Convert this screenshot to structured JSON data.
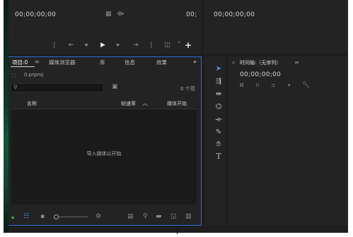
{
  "source_monitor": {
    "timecode_left": "00;00;00;00",
    "timecode_right": "00;",
    "icons": [
      "film-icon",
      "arrow-in-icon",
      "mark-in-icon",
      "mark-in-bracket-icon",
      "step-back-icon",
      "play-icon",
      "step-forward-icon",
      "mark-out-bracket-icon",
      "export-frame-icon",
      "add-icon"
    ]
  },
  "program_monitor": {
    "timecode_left": "00;00;00;00"
  },
  "project_panel": {
    "tabs": [
      {
        "label": "项目:0",
        "active": true
      },
      {
        "label": "媒体浏览器",
        "active": false
      },
      {
        "label": "库",
        "active": false
      },
      {
        "label": "信息",
        "active": false
      },
      {
        "label": "效果",
        "active": false
      }
    ],
    "overflow_label": "»",
    "project_file": "0.prproj",
    "search_placeholder": "",
    "item_count": "0 个项",
    "columns": {
      "name": "名称",
      "frame_rate": "帧速率",
      "media_start": "媒体开始"
    },
    "empty_message": "导入媒体以开始"
  },
  "timeline_panel": {
    "title": "时间轴:（无序列）",
    "timecode": "00;00;00;00"
  },
  "tools": [
    "selection-tool-icon",
    "track-select-icon",
    "ripple-edit-icon",
    "razor-icon",
    "slip-icon",
    "pen-icon",
    "hand-icon",
    "type-icon"
  ],
  "colors": {
    "background": "#1e1e1e",
    "panel": "#232323",
    "accent_blue": "#2d6bd6",
    "active_tool": "#5b8fe0",
    "lock_green": "#36b04a"
  }
}
